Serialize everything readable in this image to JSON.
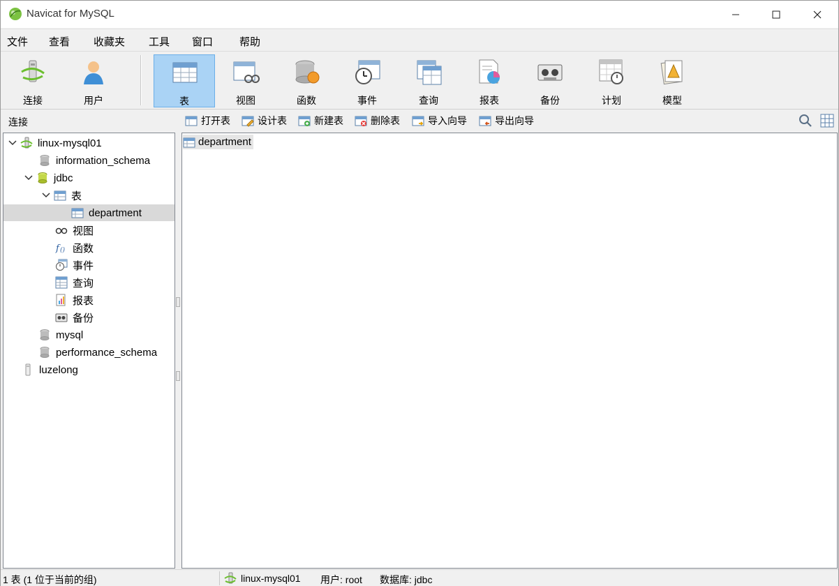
{
  "window": {
    "title": "Navicat for MySQL"
  },
  "menu": [
    "文件",
    "查看",
    "收藏夹",
    "工具",
    "窗口",
    "帮助"
  ],
  "toolbar": {
    "items": [
      {
        "label": "连接",
        "icon": "connection-icon"
      },
      {
        "label": "用户",
        "icon": "user-icon"
      },
      {
        "label": "表",
        "icon": "table-icon",
        "active": true
      },
      {
        "label": "视图",
        "icon": "view-icon"
      },
      {
        "label": "函数",
        "icon": "function-icon"
      },
      {
        "label": "事件",
        "icon": "event-icon"
      },
      {
        "label": "查询",
        "icon": "query-icon"
      },
      {
        "label": "报表",
        "icon": "report-icon"
      },
      {
        "label": "备份",
        "icon": "backup-icon"
      },
      {
        "label": "计划",
        "icon": "schedule-icon"
      },
      {
        "label": "模型",
        "icon": "model-icon"
      }
    ]
  },
  "subbar": {
    "section_label": "连接",
    "actions": [
      "打开表",
      "设计表",
      "新建表",
      "删除表",
      "导入向导",
      "导出向导"
    ]
  },
  "tree": {
    "connection": "linux-mysql01",
    "databases": {
      "information_schema": "information_schema",
      "jdbc": "jdbc",
      "tables_group": "表",
      "department": "department",
      "views": "视图",
      "functions": "函数",
      "events": "事件",
      "queries": "查询",
      "reports": "报表",
      "backups": "备份",
      "mysql": "mysql",
      "performance_schema": "performance_schema"
    },
    "connection2": "luzelong"
  },
  "content": {
    "items": [
      "department"
    ]
  },
  "status": {
    "left": "1 表 (1 位于当前的组)",
    "connection": "linux-mysql01",
    "user": "用户: root",
    "database": "数据库: jdbc"
  },
  "colors": {
    "accent": "#aad3f5",
    "selection": "#d9d9d9"
  }
}
